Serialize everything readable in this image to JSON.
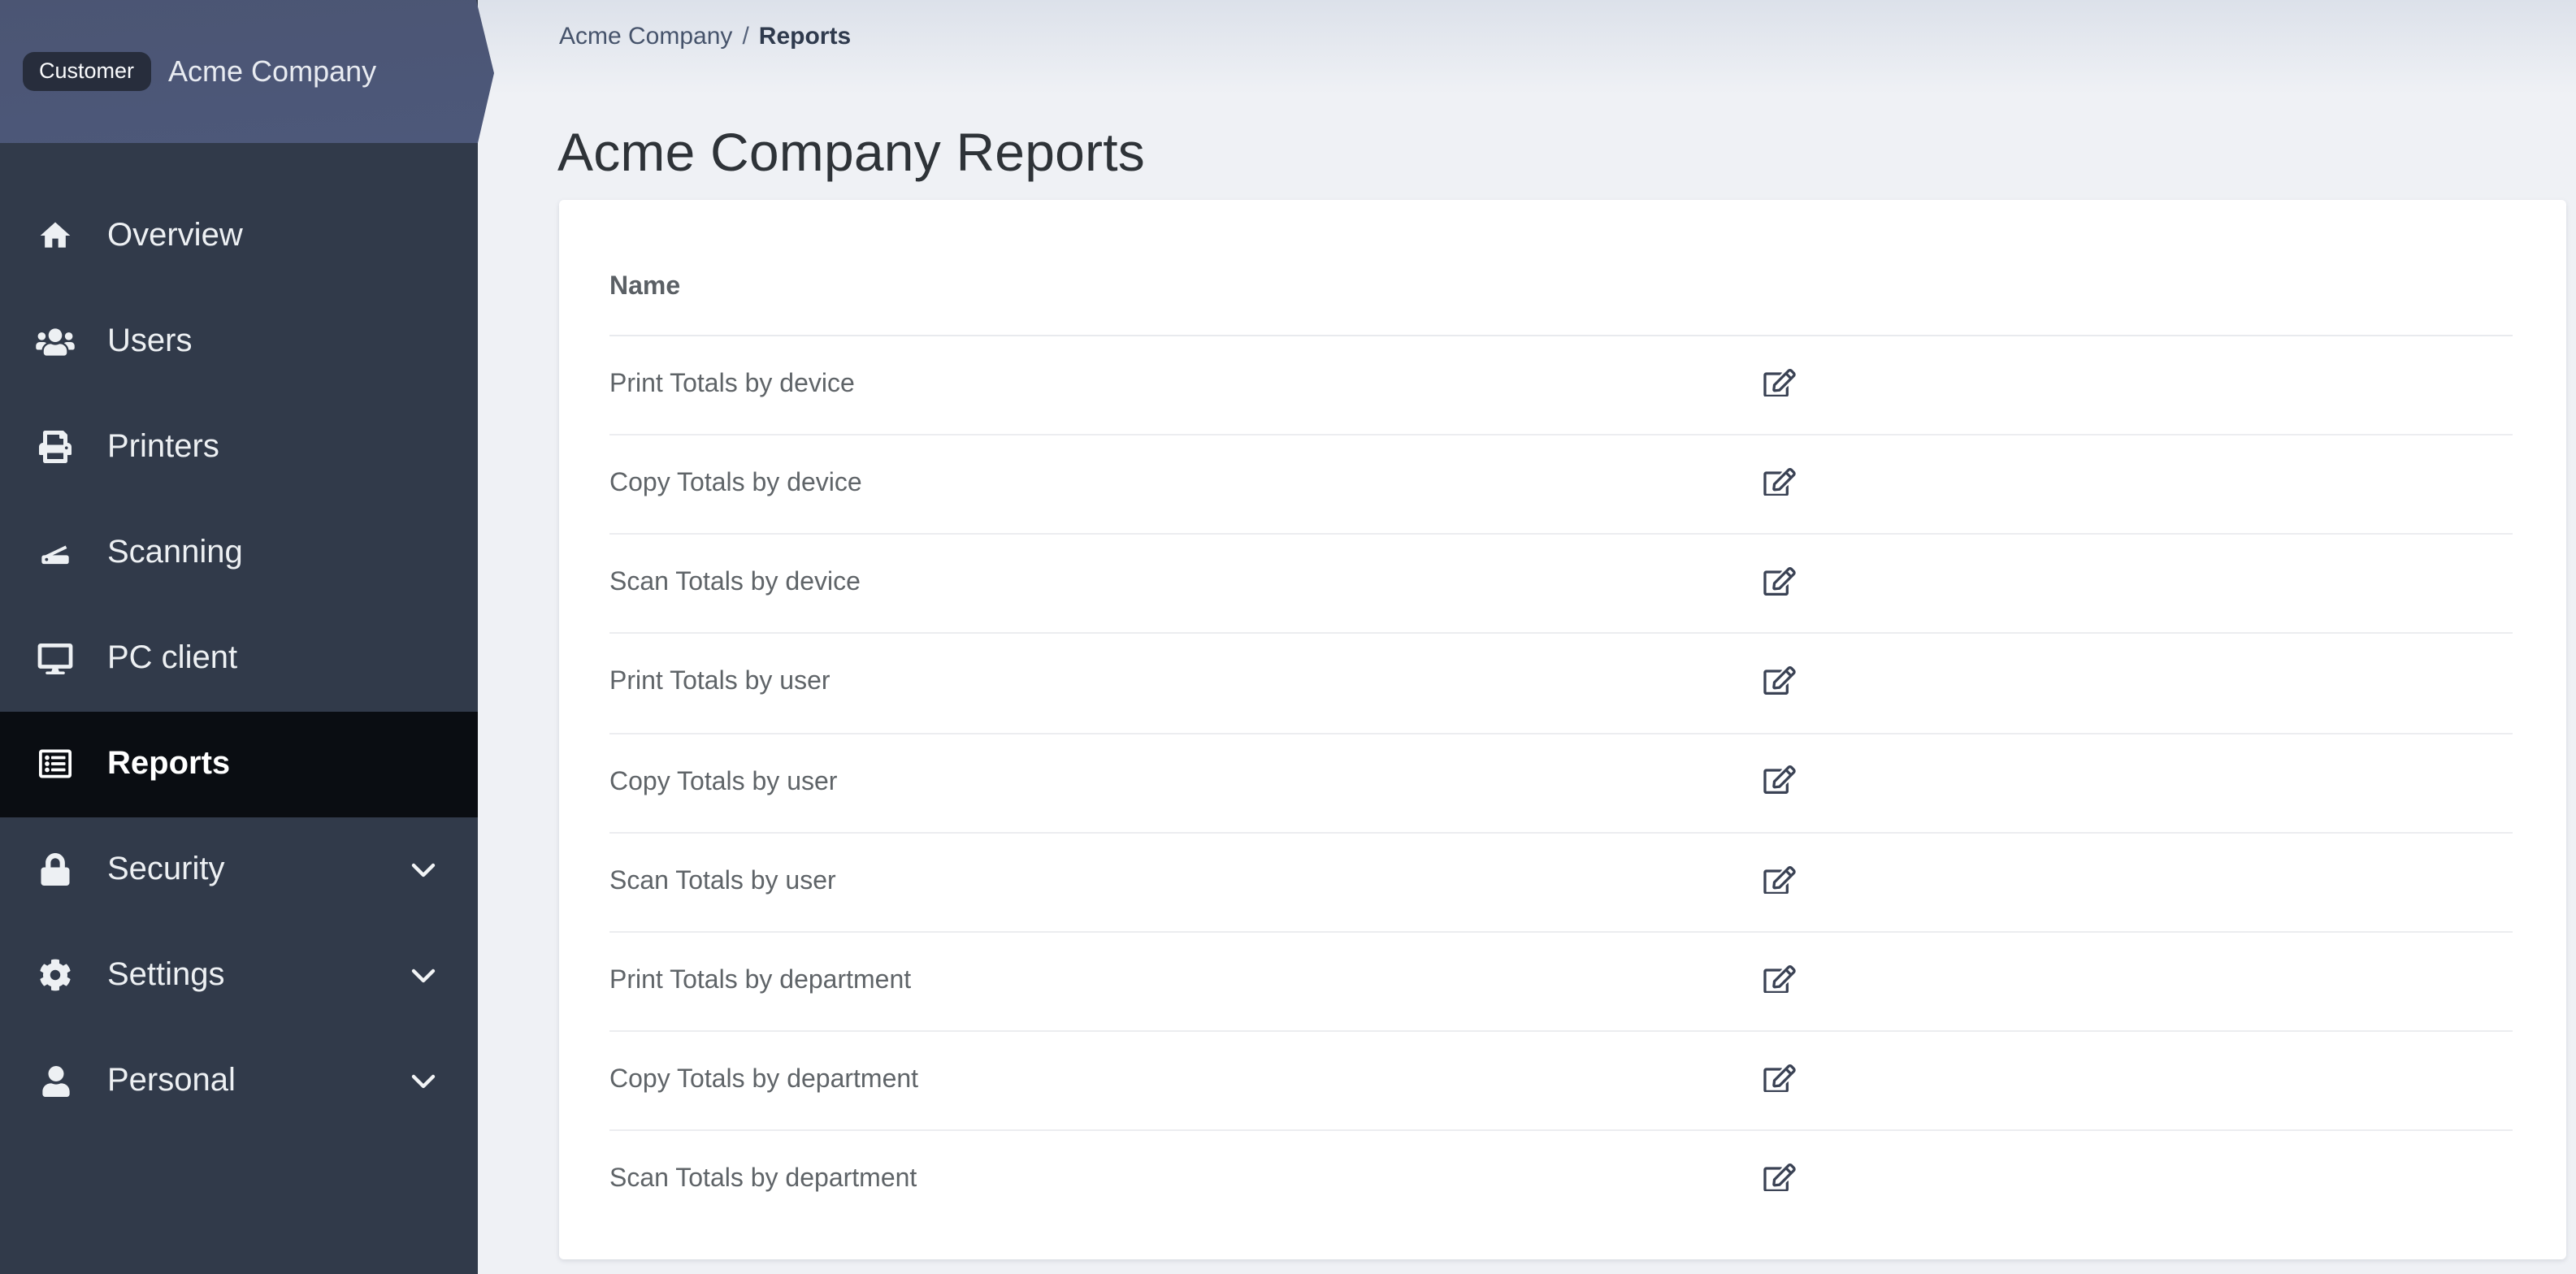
{
  "colors": {
    "sidebar_bg": "#313a4a",
    "sidebar_selected_bg": "#0a0d12",
    "brand_band_top": "#4b5573",
    "brand_band_bottom": "#4d587a",
    "badge_bg": "#272d3c",
    "page_bg": "#eff1f5",
    "card_bg": "#ffffff",
    "row_text": "#5f6468",
    "action_icon": "#3a4254"
  },
  "sidebar": {
    "customer_badge": "Customer",
    "company_name": "Acme Company",
    "items": [
      {
        "label": "Overview",
        "icon": "home-icon",
        "selected": false,
        "has_submenu": false
      },
      {
        "label": "Users",
        "icon": "users-icon",
        "selected": false,
        "has_submenu": false
      },
      {
        "label": "Printers",
        "icon": "printer-icon",
        "selected": false,
        "has_submenu": false
      },
      {
        "label": "Scanning",
        "icon": "scanner-icon",
        "selected": false,
        "has_submenu": false
      },
      {
        "label": "PC client",
        "icon": "desktop-icon",
        "selected": false,
        "has_submenu": false
      },
      {
        "label": "Reports",
        "icon": "reports-icon",
        "selected": true,
        "has_submenu": false
      },
      {
        "label": "Security",
        "icon": "lock-icon",
        "selected": false,
        "has_submenu": true
      },
      {
        "label": "Settings",
        "icon": "gear-icon",
        "selected": false,
        "has_submenu": true
      },
      {
        "label": "Personal",
        "icon": "user-icon",
        "selected": false,
        "has_submenu": true
      }
    ]
  },
  "breadcrumb": {
    "parent": "Acme Company",
    "separator": "/",
    "current": "Reports"
  },
  "page": {
    "title": "Acme Company Reports"
  },
  "reports_table": {
    "name_column_header": "Name",
    "row_action_icon": "edit-icon",
    "rows": [
      "Print Totals by device",
      "Copy Totals by device",
      "Scan Totals by device",
      "Print Totals by user",
      "Copy Totals by user",
      "Scan Totals by user",
      "Print Totals by department",
      "Copy Totals by department",
      "Scan Totals by department"
    ]
  }
}
